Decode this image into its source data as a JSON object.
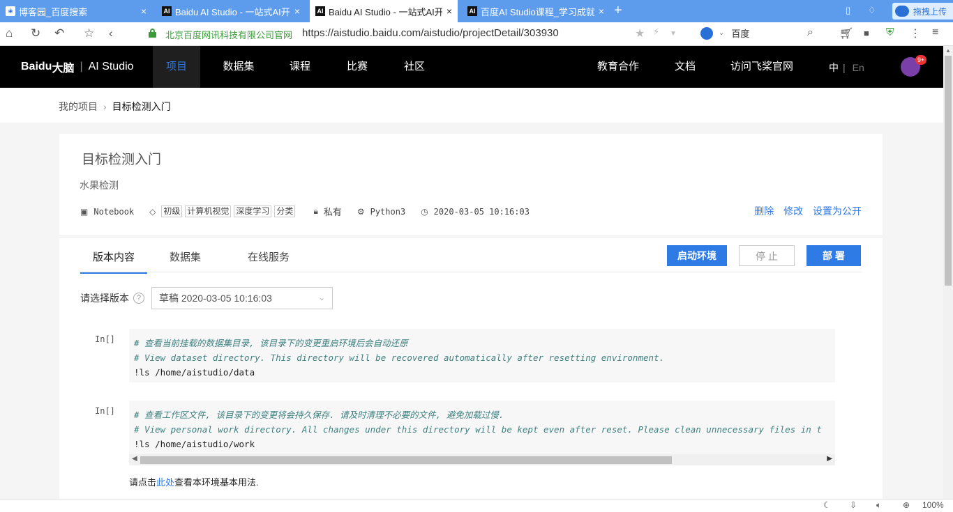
{
  "browser": {
    "tabs": [
      {
        "title": "博客园_百度搜索",
        "icon": "paw-icon"
      },
      {
        "title": "Baidu AI Studio - 一站式AI开",
        "icon": "ai-icon"
      },
      {
        "title": "Baidu AI Studio - 一站式AI开",
        "icon": "ai-icon"
      },
      {
        "title": "百度AI Studio课程_学习成就梦",
        "icon": "ai-icon"
      }
    ],
    "cloud_label": "拖拽上传",
    "security_name": "北京百度网讯科技有限公司官网",
    "url": "https://aistudio.baidu.com/aistudio/projectDetail/303930",
    "search_engine": "百度",
    "zoom": "100%"
  },
  "site": {
    "logo": {
      "brand": "Bai",
      "paw": "du",
      "brand2": "大脑",
      "product": "AI Studio"
    },
    "nav": [
      "项目",
      "数据集",
      "课程",
      "比赛",
      "社区"
    ],
    "right_nav": [
      "教育合作",
      "文档",
      "访问飞桨官网"
    ],
    "lang": {
      "zh": "中",
      "en": "En"
    },
    "avatar_badge": "9+"
  },
  "breadcrumb": {
    "parent": "我的项目",
    "current": "目标检测入门"
  },
  "project": {
    "title": "目标检测入门",
    "subtitle": "水果检测",
    "type": "Notebook",
    "tags": [
      "初级",
      "计算机视觉",
      "深度学习",
      "分类"
    ],
    "visibility": "私有",
    "env": "Python3",
    "time": "2020-03-05 10:16:03",
    "actions": [
      "删除",
      "修改",
      "设置为公开"
    ]
  },
  "content_tabs": [
    "版本内容",
    "数据集",
    "在线服务"
  ],
  "buttons": {
    "start": "启动环境",
    "stop": "停 止",
    "deploy": "部 署"
  },
  "version": {
    "label": "请选择版本",
    "help": "?",
    "selected": "草稿 2020-03-05 10:16:03"
  },
  "cells": [
    {
      "prompt": "In[]",
      "comment_cn": "# 查看当前挂载的数据集目录, 该目录下的变更重启环境后会自动还原",
      "comment_en": "# View dataset directory. This directory will be recovered automatically after resetting environment.",
      "code": "!ls /home/aistudio/data"
    },
    {
      "prompt": "In[]",
      "comment_cn": "# 查看工作区文件, 该目录下的变更将会持久保存. 请及时清理不必要的文件, 避免加载过慢.",
      "comment_en": "# View personal work directory. All changes under this directory will be kept even after reset. Please clean unnecessary files in t",
      "code": "!ls /home/aistudio/work"
    }
  ],
  "note": {
    "pre": "请点击",
    "link": "此处",
    "post": "查看本环境基本用法."
  }
}
